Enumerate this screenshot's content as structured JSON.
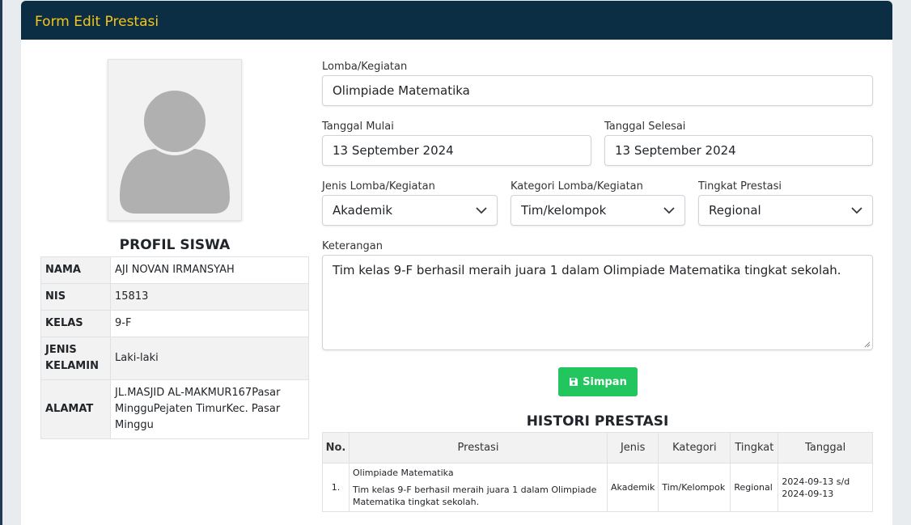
{
  "header": {
    "title": "Form Edit Prestasi"
  },
  "profile": {
    "title": "PROFIL SISWA",
    "rows": [
      {
        "key": "NAMA",
        "value": "AJI NOVAN IRMANSYAH"
      },
      {
        "key": "NIS",
        "value": "15813"
      },
      {
        "key": "KELAS",
        "value": "9-F"
      },
      {
        "key": "JENIS KELAMIN",
        "value": "Laki-laki"
      },
      {
        "key": "ALAMAT",
        "value": "JL.MASJID AL-MAKMUR167Pasar MingguPejaten TimurKec. Pasar Minggu"
      }
    ]
  },
  "form": {
    "lomba_label": "Lomba/Kegiatan",
    "lomba_value": "Olimpiade Matematika",
    "mulai_label": "Tanggal Mulai",
    "mulai_value": "13 September 2024",
    "selesai_label": "Tanggal Selesai",
    "selesai_value": "13 September 2024",
    "jenis_label": "Jenis Lomba/Kegiatan",
    "jenis_value": "Akademik",
    "kategori_label": "Kategori Lomba/Kegiatan",
    "kategori_value": "Tim/kelompok",
    "tingkat_label": "Tingkat Prestasi",
    "tingkat_value": "Regional",
    "keterangan_label": "Keterangan",
    "keterangan_value": "Tim kelas 9-F berhasil meraih juara 1 dalam Olimpiade Matematika tingkat sekolah.",
    "save_label": "Simpan"
  },
  "history": {
    "title": "HISTORI PRESTASI",
    "headers": [
      "No.",
      "Prestasi",
      "Jenis",
      "Kategori",
      "Tingkat",
      "Tanggal"
    ],
    "rows": [
      {
        "no": "1.",
        "prestasi_title": "Olimpiade Matematika",
        "prestasi_desc": "Tim kelas 9-F berhasil meraih juara 1 dalam Olimpiade Matematika tingkat sekolah.",
        "jenis": "Akademik",
        "kategori": "Tim/Kelompok",
        "tingkat": "Regional",
        "tanggal": "2024-09-13 s/d 2024-09-13"
      }
    ]
  },
  "colors": {
    "header_bg": "#0b2e45",
    "header_text": "#f5c518",
    "save_button": "#22c55e"
  },
  "icons": {
    "save": "floppy-disk-icon",
    "dropdown": "chevron-down-icon",
    "avatar": "user-silhouette-icon"
  }
}
